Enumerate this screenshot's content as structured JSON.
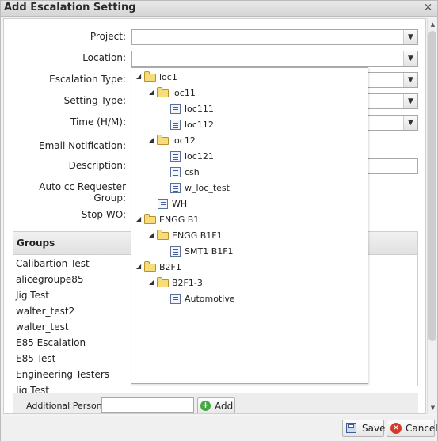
{
  "dialog": {
    "title": "Add Escalation Setting",
    "close": "×"
  },
  "form": {
    "project_label": "Project:",
    "location_label": "Location:",
    "escalation_type_label": "Escalation Type:",
    "setting_type_label": "Setting Type:",
    "time_label": "Time (H/M):",
    "email_label": "Email Notification:",
    "description_label": "Description:",
    "auto_cc_label": "Auto cc Requester Group:",
    "stop_wo_label": "Stop WO:"
  },
  "groups": {
    "header": "Groups",
    "items": [
      "Calibartion Test",
      "alicegroupe85",
      "Jig Test",
      "walter_test2",
      "walter_test",
      "E85 Escalation",
      "E85 Test",
      "Engineering Testers",
      "Jig Test"
    ]
  },
  "additional_person": {
    "label": "Additional Person:",
    "value": "",
    "add_label": "Add"
  },
  "footer": {
    "save_label": "Save",
    "cancel_label": "Cancel"
  },
  "location_tree": [
    {
      "label": "loc1",
      "type": "folder"
    },
    {
      "label": "loc11",
      "type": "folder"
    },
    {
      "label": "loc111",
      "type": "leaf"
    },
    {
      "label": "loc112",
      "type": "leaf"
    },
    {
      "label": "loc12",
      "type": "folder"
    },
    {
      "label": "loc121",
      "type": "leaf"
    },
    {
      "label": "csh",
      "type": "leaf"
    },
    {
      "label": "w_loc_test",
      "type": "leaf"
    },
    {
      "label": "WH",
      "type": "leaf"
    },
    {
      "label": "ENGG B1",
      "type": "folder"
    },
    {
      "label": "ENGG B1F1",
      "type": "folder"
    },
    {
      "label": "SMT1 B1F1",
      "type": "leaf"
    },
    {
      "label": "B2F1",
      "type": "folder"
    },
    {
      "label": "B2F1-3",
      "type": "folder"
    },
    {
      "label": "Automotive",
      "type": "leaf"
    }
  ],
  "icons": {
    "expanded": "triangle-down-icon",
    "folder": "folder-icon",
    "leaf": "location-leaf-icon"
  }
}
